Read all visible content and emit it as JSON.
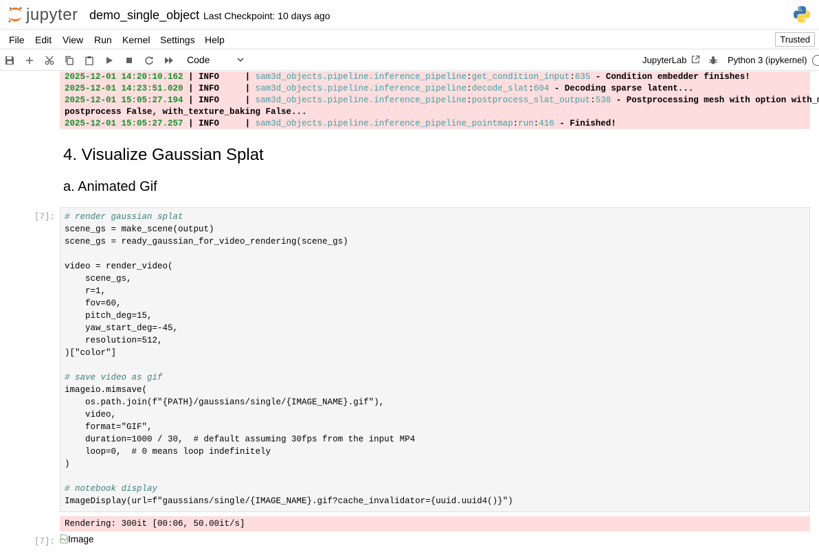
{
  "header": {
    "logo_text": "jupyter",
    "notebook_title": "demo_single_object",
    "checkpoint": "Last Checkpoint: 10 days ago"
  },
  "menu": [
    "File",
    "Edit",
    "View",
    "Run",
    "Kernel",
    "Settings",
    "Help"
  ],
  "trusted_label": "Trusted",
  "toolbar": {
    "cell_type": "Code",
    "jupyterlab_label": "JupyterLab",
    "kernel_label": "Python 3 (ipykernel)",
    "icons": [
      "save-icon",
      "add-icon",
      "cut-icon",
      "copy-icon",
      "paste-icon",
      "run-icon",
      "stop-icon",
      "restart-icon",
      "fast-forward-icon"
    ]
  },
  "log_lines": [
    {
      "ts": "2025-12-01 14:20:10.162",
      "level": "INFO",
      "module": "sam3d_objects.pipeline.inference_pipeline",
      "func": "get_condition_input",
      "line": "635",
      "msg": " - Condition embedder finishes!"
    },
    {
      "ts": "2025-12-01 14:23:51.020",
      "level": "INFO",
      "module": "sam3d_objects.pipeline.inference_pipeline",
      "func": "decode_slat",
      "line": "604",
      "msg": " - Decoding sparse latent..."
    },
    {
      "ts": "2025-12-01 15:05:27.194",
      "level": "INFO",
      "module": "sam3d_objects.pipeline.inference_pipeline",
      "func": "postprocess_slat_output",
      "line": "538",
      "msg": " - Postprocessing mesh with option with_mesh_"
    },
    {
      "cont": "postprocess False, with_texture_baking False..."
    },
    {
      "ts": "2025-12-01 15:05:27.257",
      "level": "INFO",
      "module": "sam3d_objects.pipeline.inference_pipeline_pointmap",
      "func": "run",
      "line": "416",
      "msg": " - Finished!"
    }
  ],
  "headings": {
    "h2": "4. Visualize Gaussian Splat",
    "h3": "a. Animated Gif"
  },
  "prompts": {
    "code_cell": "[7]:",
    "output": "[7]:"
  },
  "code_lines": [
    "# render gaussian splat",
    "scene_gs = make_scene(output)",
    "scene_gs = ready_gaussian_for_video_rendering(scene_gs)",
    "",
    "video = render_video(",
    "    scene_gs,",
    "    r=1,",
    "    fov=60,",
    "    pitch_deg=15,",
    "    yaw_start_deg=-45,",
    "    resolution=512,",
    ")[\"color\"]",
    "",
    "# save video as gif",
    "imageio.mimsave(",
    "    os.path.join(f\"{PATH}/gaussians/single/{IMAGE_NAME}.gif\"),",
    "    video,",
    "    format=\"GIF\",",
    "    duration=1000 / 30,  # default assuming 30fps from the input MP4",
    "    loop=0,  # 0 means loop indefinitely",
    ")",
    "",
    "# notebook display",
    "ImageDisplay(url=f\"gaussians/single/{IMAGE_NAME}.gif?cache_invalidator={uuid.uuid4()}\")"
  ],
  "rendering_output": "Rendering: 300it [00:06, 50.00it/s]",
  "image_alt": "Image",
  "colors": {
    "stderr_bg": "#fddddd",
    "code_bg": "#f5f5f5",
    "log_green": "#1a8f31",
    "log_cyan": "#43a0a8",
    "jupyter_orange": "#f37726"
  }
}
